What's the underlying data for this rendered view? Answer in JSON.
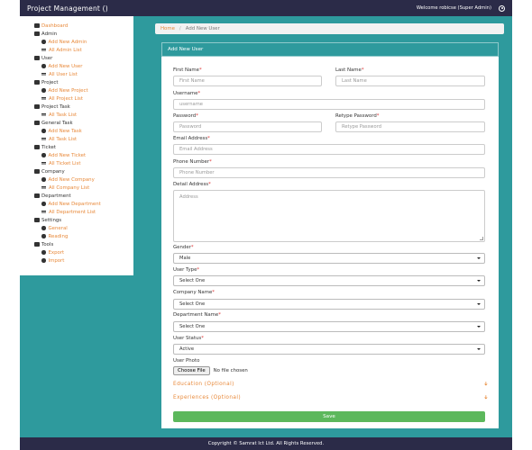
{
  "app": {
    "title": "Project Management ()",
    "welcome": "Welcome robicse (Super Admin)"
  },
  "sidebar": {
    "items": [
      {
        "label": "Dashboard",
        "icon": "dashboard-icon",
        "active": true,
        "children": []
      },
      {
        "label": "Admin",
        "icon": "user-icon",
        "children": [
          {
            "label": "Add New Admin",
            "icon": "plus-circle-icon"
          },
          {
            "label": "All Admin List",
            "icon": "list-icon"
          }
        ]
      },
      {
        "label": "User",
        "icon": "users-icon",
        "children": [
          {
            "label": "Add New User",
            "icon": "plus-circle-icon"
          },
          {
            "label": "All User List",
            "icon": "list-icon"
          }
        ]
      },
      {
        "label": "Project",
        "icon": "file-icon",
        "children": [
          {
            "label": "Add New Project",
            "icon": "plus-circle-icon"
          },
          {
            "label": "All Project List",
            "icon": "list-icon"
          }
        ]
      },
      {
        "label": "Project Task",
        "icon": "doc-icon",
        "children": [
          {
            "label": "All Task List",
            "icon": "list-icon"
          }
        ]
      },
      {
        "label": "General Task",
        "icon": "share-icon",
        "children": [
          {
            "label": "Add New Task",
            "icon": "plus-circle-icon"
          },
          {
            "label": "All Task List",
            "icon": "list-icon"
          }
        ]
      },
      {
        "label": "Ticket",
        "icon": "tag-icon",
        "children": [
          {
            "label": "Add New Ticket",
            "icon": "plus-circle-icon"
          },
          {
            "label": "All Ticket List",
            "icon": "list-icon"
          }
        ]
      },
      {
        "label": "Company",
        "icon": "briefcase-icon",
        "children": [
          {
            "label": "Add New Company",
            "icon": "plus-circle-icon"
          },
          {
            "label": "All Company List",
            "icon": "list-icon"
          }
        ]
      },
      {
        "label": "Department",
        "icon": "tags-icon",
        "children": [
          {
            "label": "Add New Department",
            "icon": "plus-circle-icon"
          },
          {
            "label": "All Department List",
            "icon": "list-icon"
          }
        ]
      },
      {
        "label": "Settings",
        "icon": "wrench-icon",
        "children": [
          {
            "label": "General",
            "icon": "circle-icon"
          },
          {
            "label": "Reading",
            "icon": "edit-icon"
          }
        ]
      },
      {
        "label": "Tools",
        "icon": "tools-icon",
        "children": [
          {
            "label": "Export",
            "icon": "arrow-circle-icon"
          },
          {
            "label": "Import",
            "icon": "arrow-circle-icon"
          }
        ]
      }
    ]
  },
  "breadcrumb": {
    "home": "Home",
    "separator": "/",
    "current": "Add New User"
  },
  "form": {
    "title": "Add New User",
    "first_name": {
      "label": "First Name",
      "placeholder": "First Name"
    },
    "last_name": {
      "label": "Last Name",
      "placeholder": "Last Name"
    },
    "username": {
      "label": "Username",
      "placeholder": "username"
    },
    "password": {
      "label": "Password",
      "placeholder": "Password"
    },
    "retype_password": {
      "label": "Retype Password",
      "placeholder": "Retype Password"
    },
    "email": {
      "label": "Email Address",
      "placeholder": "Email Address"
    },
    "phone": {
      "label": "Phone Number",
      "placeholder": "Phone Number"
    },
    "address": {
      "label": "Detail Address",
      "placeholder": "Address"
    },
    "gender": {
      "label": "Gender",
      "value": "Male"
    },
    "user_type": {
      "label": "User Type",
      "value": "Select One"
    },
    "company": {
      "label": "Company Name",
      "value": "Select One"
    },
    "department": {
      "label": "Department Name",
      "value": "Select One"
    },
    "status": {
      "label": "User Status",
      "value": "Active"
    },
    "photo": {
      "label": "User Photo",
      "button": "Choose File",
      "status": "No file chosen"
    },
    "education": "Education (Optional)",
    "experiences": "Experiences (Optional)",
    "save": "Save",
    "required_mark": "*"
  },
  "footer": {
    "text": "Copyright © Samrat Ict Ltd. All Rights Reserved."
  },
  "colors": {
    "topbar": "#2b2b48",
    "teal": "#2e9a9d",
    "accent": "#e8893a",
    "save": "#5cb85c"
  }
}
